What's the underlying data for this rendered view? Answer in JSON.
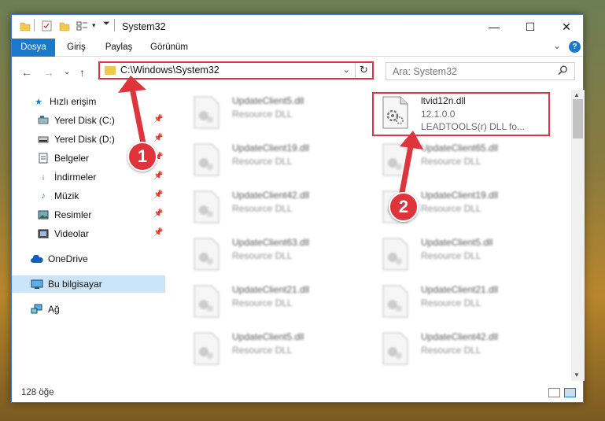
{
  "window": {
    "title": "System32",
    "minimize_glyph": "—",
    "maximize_glyph": "☐",
    "close_glyph": "✕"
  },
  "ribbon": {
    "tabs": [
      {
        "label": "Dosya",
        "active": true
      },
      {
        "label": "Giriş",
        "active": false
      },
      {
        "label": "Paylaş",
        "active": false
      },
      {
        "label": "Görünüm",
        "active": false
      }
    ],
    "expand_glyph": "⌄",
    "help_glyph": "?"
  },
  "navigation": {
    "back_glyph": "←",
    "forward_glyph": "→",
    "recent_glyph": "⌄",
    "up_glyph": "↑"
  },
  "address": {
    "path": "C:\\Windows\\System32",
    "dropdown_glyph": "⌄",
    "refresh_glyph": "↻"
  },
  "search": {
    "placeholder": "Ara: System32",
    "icon": "search-icon"
  },
  "sidebar": {
    "items": [
      {
        "label": "Hızlı erişim",
        "icon": "star-icon",
        "pinned": false,
        "selected": false
      },
      {
        "label": "Yerel Disk (C:)",
        "icon": "disk-icon",
        "pinned": true,
        "selected": false
      },
      {
        "label": "Yerel Disk (D:)",
        "icon": "disk-icon",
        "pinned": true,
        "selected": false
      },
      {
        "label": "Belgeler",
        "icon": "documents-icon",
        "pinned": true,
        "selected": false
      },
      {
        "label": "İndirmeler",
        "icon": "download-icon",
        "pinned": true,
        "selected": false
      },
      {
        "label": "Müzik",
        "icon": "music-icon",
        "pinned": true,
        "selected": false
      },
      {
        "label": "Resimler",
        "icon": "pictures-icon",
        "pinned": true,
        "selected": false
      },
      {
        "label": "Videolar",
        "icon": "videos-icon",
        "pinned": true,
        "selected": false
      },
      {
        "label": "OneDrive",
        "icon": "cloud-icon",
        "pinned": false,
        "selected": false
      },
      {
        "label": "Bu bilgisayar",
        "icon": "computer-icon",
        "pinned": false,
        "selected": true
      },
      {
        "label": "Ağ",
        "icon": "network-icon",
        "pinned": false,
        "selected": false
      }
    ],
    "pin_glyph": "📌"
  },
  "files": {
    "highlighted": {
      "name": "ltvid12n.dll",
      "version": "12.1.0.0",
      "company": "LEADTOOLS(r) DLL fo..."
    },
    "left_column": [
      {
        "name": "UpdateClient5.dll",
        "desc": "Resource DLL"
      },
      {
        "name": "UpdateClient19.dll",
        "desc": "Resource DLL"
      },
      {
        "name": "UpdateClient42.dll",
        "desc": "Resource DLL"
      },
      {
        "name": "UpdateClient63.dll",
        "desc": "Resource DLL"
      },
      {
        "name": "UpdateClient21.dll",
        "desc": "Resource DLL"
      },
      {
        "name": "UpdateClient5.dll",
        "desc": "Resource DLL"
      }
    ],
    "right_column": [
      {
        "name": "UpdateClient65.dll",
        "desc": "Resource DLL"
      },
      {
        "name": "UpdateClient19.dll",
        "desc": "Resource DLL"
      },
      {
        "name": "UpdateClient5.dll",
        "desc": "Resource DLL"
      },
      {
        "name": "UpdateClient21.dll",
        "desc": "Resource DLL"
      },
      {
        "name": "UpdateClient42.dll",
        "desc": "Resource DLL"
      }
    ]
  },
  "status": {
    "item_count": "128 öğe"
  },
  "callouts": [
    {
      "number": "1",
      "color": "#e0343c"
    },
    {
      "number": "2",
      "color": "#e0343c"
    }
  ],
  "colors": {
    "accent": "#1979ca",
    "highlight": "#e0343c",
    "selection": "#cce4f7"
  }
}
